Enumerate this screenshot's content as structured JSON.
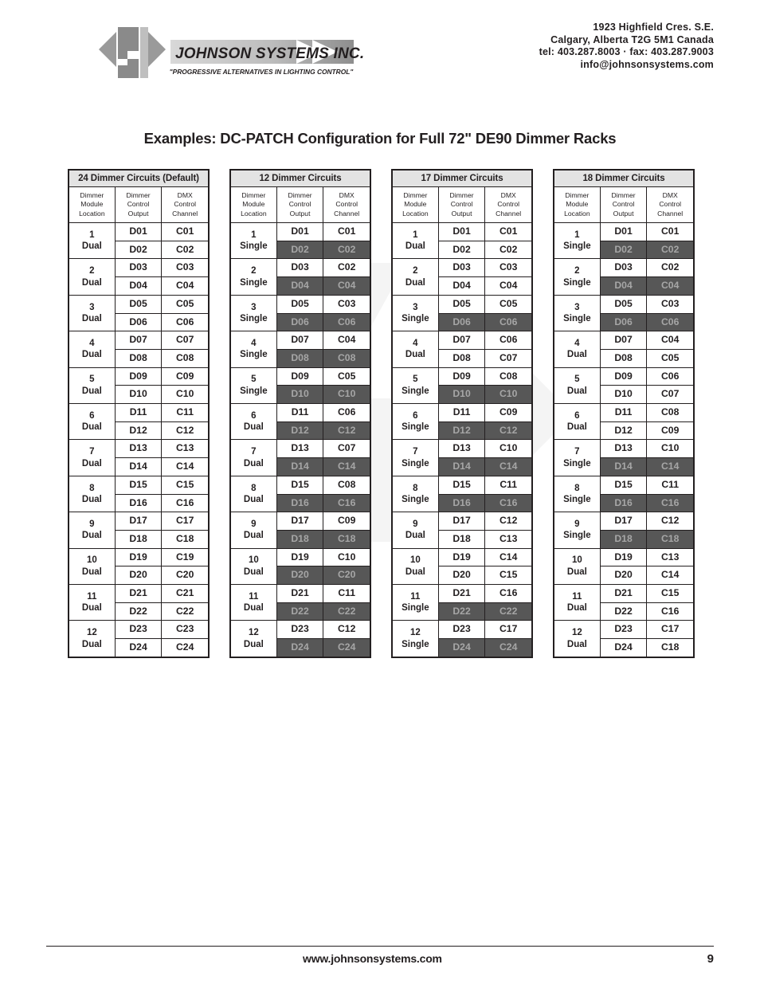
{
  "header": {
    "logo_name": "JOHNSON SYSTEMS INC.",
    "logo_tagline": "\"PROGRESSIVE ALTERNATIVES IN LIGHTING CONTROL\"",
    "contact": [
      "1923 Highfield Cres. S.E.",
      "Calgary, Alberta  T2G 5M1 Canada",
      "tel: 403.287.8003 · fax: 403.287.9003",
      "info@johnsonsystems.com"
    ]
  },
  "title": "Examples: DC-PATCH Configuration for Full 72\" DE90 Dimmer Racks",
  "column_headers": {
    "location": [
      "Dimmer",
      "Module",
      "Location"
    ],
    "output": [
      "Dimmer",
      "Control",
      "Output"
    ],
    "channel": [
      "DMX",
      "Control",
      "Channel"
    ]
  },
  "colors": {
    "header_band": "#e3e3e3",
    "disabled_bg": "#575757",
    "disabled_text": "#a6a6a6",
    "ink": "#231f20"
  },
  "tables": [
    {
      "title": "24 Dimmer Circuits (Default)",
      "modules": [
        {
          "num": "1",
          "type": "Dual",
          "rows": [
            {
              "out": "D01",
              "ch": "C01",
              "off": false
            },
            {
              "out": "D02",
              "ch": "C02",
              "off": false
            }
          ]
        },
        {
          "num": "2",
          "type": "Dual",
          "rows": [
            {
              "out": "D03",
              "ch": "C03",
              "off": false
            },
            {
              "out": "D04",
              "ch": "C04",
              "off": false
            }
          ]
        },
        {
          "num": "3",
          "type": "Dual",
          "rows": [
            {
              "out": "D05",
              "ch": "C05",
              "off": false
            },
            {
              "out": "D06",
              "ch": "C06",
              "off": false
            }
          ]
        },
        {
          "num": "4",
          "type": "Dual",
          "rows": [
            {
              "out": "D07",
              "ch": "C07",
              "off": false
            },
            {
              "out": "D08",
              "ch": "C08",
              "off": false
            }
          ]
        },
        {
          "num": "5",
          "type": "Dual",
          "rows": [
            {
              "out": "D09",
              "ch": "C09",
              "off": false
            },
            {
              "out": "D10",
              "ch": "C10",
              "off": false
            }
          ]
        },
        {
          "num": "6",
          "type": "Dual",
          "rows": [
            {
              "out": "D11",
              "ch": "C11",
              "off": false
            },
            {
              "out": "D12",
              "ch": "C12",
              "off": false
            }
          ]
        },
        {
          "num": "7",
          "type": "Dual",
          "rows": [
            {
              "out": "D13",
              "ch": "C13",
              "off": false
            },
            {
              "out": "D14",
              "ch": "C14",
              "off": false
            }
          ]
        },
        {
          "num": "8",
          "type": "Dual",
          "rows": [
            {
              "out": "D15",
              "ch": "C15",
              "off": false
            },
            {
              "out": "D16",
              "ch": "C16",
              "off": false
            }
          ]
        },
        {
          "num": "9",
          "type": "Dual",
          "rows": [
            {
              "out": "D17",
              "ch": "C17",
              "off": false
            },
            {
              "out": "D18",
              "ch": "C18",
              "off": false
            }
          ]
        },
        {
          "num": "10",
          "type": "Dual",
          "rows": [
            {
              "out": "D19",
              "ch": "C19",
              "off": false
            },
            {
              "out": "D20",
              "ch": "C20",
              "off": false
            }
          ]
        },
        {
          "num": "11",
          "type": "Dual",
          "rows": [
            {
              "out": "D21",
              "ch": "C21",
              "off": false
            },
            {
              "out": "D22",
              "ch": "C22",
              "off": false
            }
          ]
        },
        {
          "num": "12",
          "type": "Dual",
          "rows": [
            {
              "out": "D23",
              "ch": "C23",
              "off": false
            },
            {
              "out": "D24",
              "ch": "C24",
              "off": false
            }
          ]
        }
      ]
    },
    {
      "title": "12 Dimmer Circuits",
      "modules": [
        {
          "num": "1",
          "type": "Single",
          "rows": [
            {
              "out": "D01",
              "ch": "C01",
              "off": false
            },
            {
              "out": "D02",
              "ch": "C02",
              "off": true
            }
          ]
        },
        {
          "num": "2",
          "type": "Single",
          "rows": [
            {
              "out": "D03",
              "ch": "C02",
              "off": false
            },
            {
              "out": "D04",
              "ch": "C04",
              "off": true
            }
          ]
        },
        {
          "num": "3",
          "type": "Single",
          "rows": [
            {
              "out": "D05",
              "ch": "C03",
              "off": false
            },
            {
              "out": "D06",
              "ch": "C06",
              "off": true
            }
          ]
        },
        {
          "num": "4",
          "type": "Single",
          "rows": [
            {
              "out": "D07",
              "ch": "C04",
              "off": false
            },
            {
              "out": "D08",
              "ch": "C08",
              "off": true
            }
          ]
        },
        {
          "num": "5",
          "type": "Single",
          "rows": [
            {
              "out": "D09",
              "ch": "C05",
              "off": false
            },
            {
              "out": "D10",
              "ch": "C10",
              "off": true
            }
          ]
        },
        {
          "num": "6",
          "type": "Dual",
          "rows": [
            {
              "out": "D11",
              "ch": "C06",
              "off": false
            },
            {
              "out": "D12",
              "ch": "C12",
              "off": true
            }
          ]
        },
        {
          "num": "7",
          "type": "Dual",
          "rows": [
            {
              "out": "D13",
              "ch": "C07",
              "off": false
            },
            {
              "out": "D14",
              "ch": "C14",
              "off": true
            }
          ]
        },
        {
          "num": "8",
          "type": "Dual",
          "rows": [
            {
              "out": "D15",
              "ch": "C08",
              "off": false
            },
            {
              "out": "D16",
              "ch": "C16",
              "off": true
            }
          ]
        },
        {
          "num": "9",
          "type": "Dual",
          "rows": [
            {
              "out": "D17",
              "ch": "C09",
              "off": false
            },
            {
              "out": "D18",
              "ch": "C18",
              "off": true
            }
          ]
        },
        {
          "num": "10",
          "type": "Dual",
          "rows": [
            {
              "out": "D19",
              "ch": "C10",
              "off": false
            },
            {
              "out": "D20",
              "ch": "C20",
              "off": true
            }
          ]
        },
        {
          "num": "11",
          "type": "Dual",
          "rows": [
            {
              "out": "D21",
              "ch": "C11",
              "off": false
            },
            {
              "out": "D22",
              "ch": "C22",
              "off": true
            }
          ]
        },
        {
          "num": "12",
          "type": "Dual",
          "rows": [
            {
              "out": "D23",
              "ch": "C12",
              "off": false
            },
            {
              "out": "D24",
              "ch": "C24",
              "off": true
            }
          ]
        }
      ]
    },
    {
      "title": "17 Dimmer Circuits",
      "modules": [
        {
          "num": "1",
          "type": "Dual",
          "rows": [
            {
              "out": "D01",
              "ch": "C01",
              "off": false
            },
            {
              "out": "D02",
              "ch": "C02",
              "off": false
            }
          ]
        },
        {
          "num": "2",
          "type": "Dual",
          "rows": [
            {
              "out": "D03",
              "ch": "C03",
              "off": false
            },
            {
              "out": "D04",
              "ch": "C04",
              "off": false
            }
          ]
        },
        {
          "num": "3",
          "type": "Single",
          "rows": [
            {
              "out": "D05",
              "ch": "C05",
              "off": false
            },
            {
              "out": "D06",
              "ch": "C06",
              "off": true
            }
          ]
        },
        {
          "num": "4",
          "type": "Dual",
          "rows": [
            {
              "out": "D07",
              "ch": "C06",
              "off": false
            },
            {
              "out": "D08",
              "ch": "C07",
              "off": false
            }
          ]
        },
        {
          "num": "5",
          "type": "Single",
          "rows": [
            {
              "out": "D09",
              "ch": "C08",
              "off": false
            },
            {
              "out": "D10",
              "ch": "C10",
              "off": true
            }
          ]
        },
        {
          "num": "6",
          "type": "Single",
          "rows": [
            {
              "out": "D11",
              "ch": "C09",
              "off": false
            },
            {
              "out": "D12",
              "ch": "C12",
              "off": true
            }
          ]
        },
        {
          "num": "7",
          "type": "Single",
          "rows": [
            {
              "out": "D13",
              "ch": "C10",
              "off": false
            },
            {
              "out": "D14",
              "ch": "C14",
              "off": true
            }
          ]
        },
        {
          "num": "8",
          "type": "Single",
          "rows": [
            {
              "out": "D15",
              "ch": "C11",
              "off": false
            },
            {
              "out": "D16",
              "ch": "C16",
              "off": true
            }
          ]
        },
        {
          "num": "9",
          "type": "Dual",
          "rows": [
            {
              "out": "D17",
              "ch": "C12",
              "off": false
            },
            {
              "out": "D18",
              "ch": "C13",
              "off": false
            }
          ]
        },
        {
          "num": "10",
          "type": "Dual",
          "rows": [
            {
              "out": "D19",
              "ch": "C14",
              "off": false
            },
            {
              "out": "D20",
              "ch": "C15",
              "off": false
            }
          ]
        },
        {
          "num": "11",
          "type": "Single",
          "rows": [
            {
              "out": "D21",
              "ch": "C16",
              "off": false
            },
            {
              "out": "D22",
              "ch": "C22",
              "off": true
            }
          ]
        },
        {
          "num": "12",
          "type": "Single",
          "rows": [
            {
              "out": "D23",
              "ch": "C17",
              "off": false
            },
            {
              "out": "D24",
              "ch": "C24",
              "off": true
            }
          ]
        }
      ]
    },
    {
      "title": "18 Dimmer Circuits",
      "modules": [
        {
          "num": "1",
          "type": "Single",
          "rows": [
            {
              "out": "D01",
              "ch": "C01",
              "off": false
            },
            {
              "out": "D02",
              "ch": "C02",
              "off": true
            }
          ]
        },
        {
          "num": "2",
          "type": "Single",
          "rows": [
            {
              "out": "D03",
              "ch": "C02",
              "off": false
            },
            {
              "out": "D04",
              "ch": "C04",
              "off": true
            }
          ]
        },
        {
          "num": "3",
          "type": "Single",
          "rows": [
            {
              "out": "D05",
              "ch": "C03",
              "off": false
            },
            {
              "out": "D06",
              "ch": "C06",
              "off": true
            }
          ]
        },
        {
          "num": "4",
          "type": "Dual",
          "rows": [
            {
              "out": "D07",
              "ch": "C04",
              "off": false
            },
            {
              "out": "D08",
              "ch": "C05",
              "off": false
            }
          ]
        },
        {
          "num": "5",
          "type": "Dual",
          "rows": [
            {
              "out": "D09",
              "ch": "C06",
              "off": false
            },
            {
              "out": "D10",
              "ch": "C07",
              "off": false
            }
          ]
        },
        {
          "num": "6",
          "type": "Dual",
          "rows": [
            {
              "out": "D11",
              "ch": "C08",
              "off": false
            },
            {
              "out": "D12",
              "ch": "C09",
              "off": false
            }
          ]
        },
        {
          "num": "7",
          "type": "Single",
          "rows": [
            {
              "out": "D13",
              "ch": "C10",
              "off": false
            },
            {
              "out": "D14",
              "ch": "C14",
              "off": true
            }
          ]
        },
        {
          "num": "8",
          "type": "Single",
          "rows": [
            {
              "out": "D15",
              "ch": "C11",
              "off": false
            },
            {
              "out": "D16",
              "ch": "C16",
              "off": true
            }
          ]
        },
        {
          "num": "9",
          "type": "Single",
          "rows": [
            {
              "out": "D17",
              "ch": "C12",
              "off": false
            },
            {
              "out": "D18",
              "ch": "C18",
              "off": true
            }
          ]
        },
        {
          "num": "10",
          "type": "Dual",
          "rows": [
            {
              "out": "D19",
              "ch": "C13",
              "off": false
            },
            {
              "out": "D20",
              "ch": "C14",
              "off": false
            }
          ]
        },
        {
          "num": "11",
          "type": "Dual",
          "rows": [
            {
              "out": "D21",
              "ch": "C15",
              "off": false
            },
            {
              "out": "D22",
              "ch": "C16",
              "off": false
            }
          ]
        },
        {
          "num": "12",
          "type": "Dual",
          "rows": [
            {
              "out": "D23",
              "ch": "C17",
              "off": false
            },
            {
              "out": "D24",
              "ch": "C18",
              "off": false
            }
          ]
        }
      ]
    }
  ],
  "footer": {
    "url": "www.johnsonsystems.com",
    "page": "9"
  }
}
